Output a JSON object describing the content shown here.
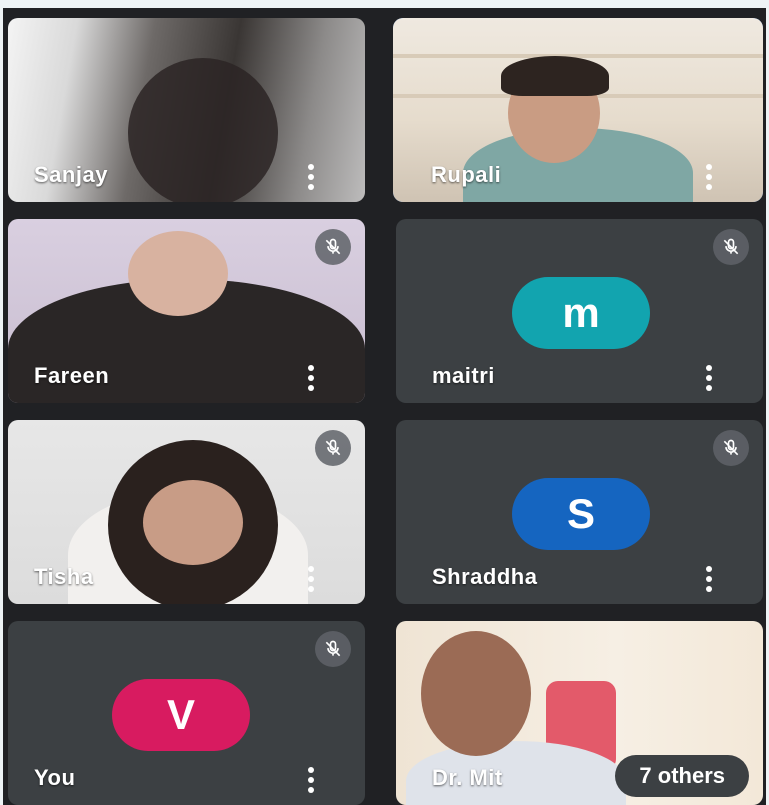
{
  "participants": [
    {
      "name": "Sanjay",
      "type": "video",
      "muted": false
    },
    {
      "name": "Rupali",
      "type": "video",
      "muted": false,
      "active_speaker": true
    },
    {
      "name": "Fareen",
      "type": "video",
      "muted": true
    },
    {
      "name": "maitri",
      "type": "avatar",
      "initial": "m",
      "avatar_color": "#12a4af",
      "muted": true
    },
    {
      "name": "Tisha",
      "type": "video",
      "muted": true
    },
    {
      "name": "Shraddha",
      "type": "avatar",
      "initial": "S",
      "avatar_color": "#1565c0",
      "muted": true
    },
    {
      "name": "You",
      "type": "avatar",
      "initial": "V",
      "avatar_color": "#d81b60",
      "muted": true
    },
    {
      "name": "Dr. Mit",
      "type": "video",
      "muted": false
    }
  ],
  "others_chip": {
    "label": "7 others"
  },
  "icons": {
    "more": "more-vert-icon",
    "mic_off": "mic-off-icon"
  },
  "colors": {
    "background": "#202124",
    "tile": "#3c4043",
    "active_border": "#1a73e8"
  }
}
